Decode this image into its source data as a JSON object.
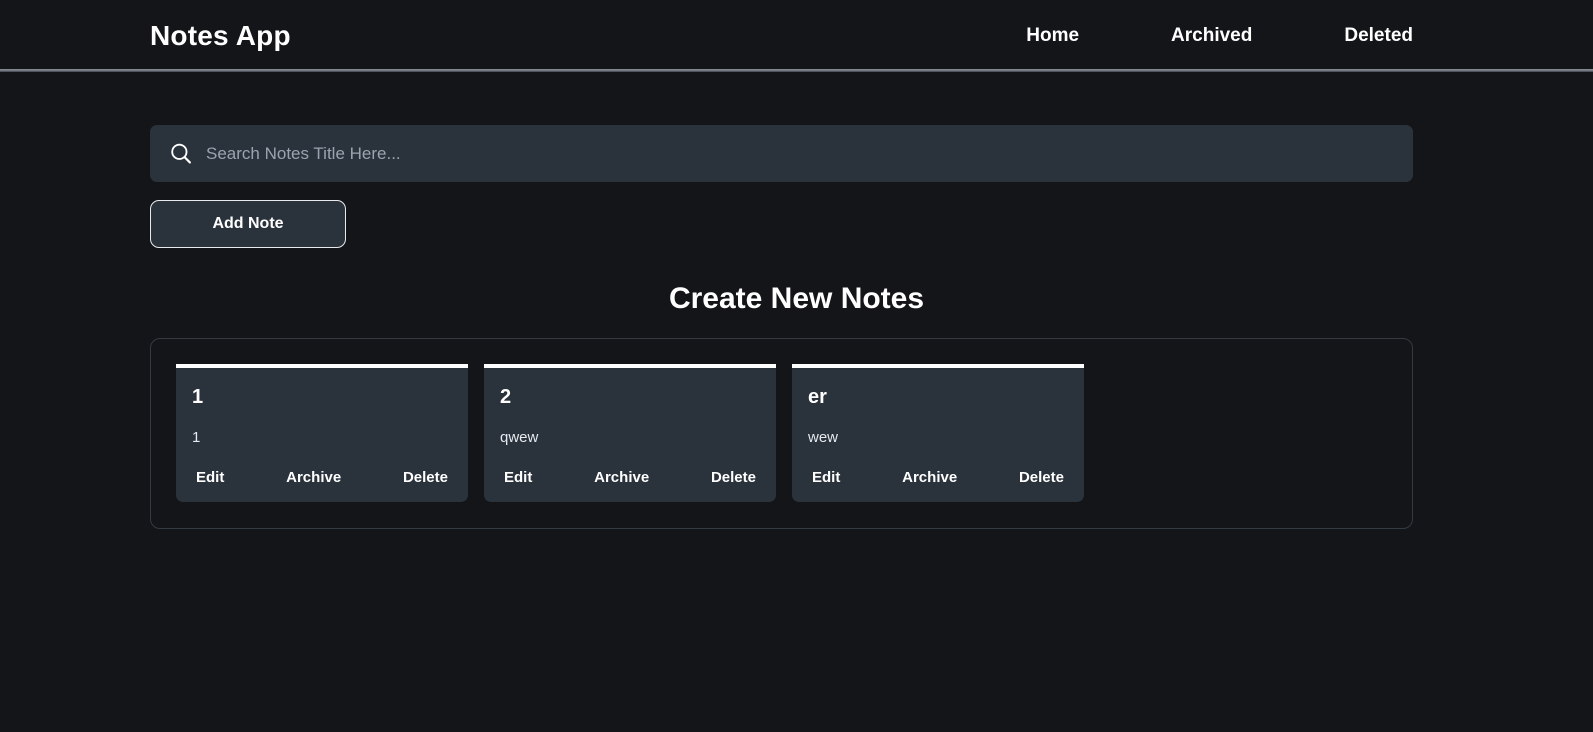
{
  "header": {
    "brand": "Notes App",
    "nav": [
      {
        "label": "Home",
        "name": "nav-link-home"
      },
      {
        "label": "Archived",
        "name": "nav-link-archived"
      },
      {
        "label": "Deleted",
        "name": "nav-link-deleted"
      }
    ]
  },
  "search": {
    "placeholder": "Search Notes Title Here...",
    "value": "",
    "icon": "search-icon"
  },
  "toolbar": {
    "add_note_label": "Add Note"
  },
  "main": {
    "section_title": "Create New Notes"
  },
  "actions": {
    "edit": "Edit",
    "archive": "Archive",
    "delete": "Delete"
  },
  "notes": [
    {
      "title": "1",
      "body": "1"
    },
    {
      "title": "2",
      "body": "qwew"
    },
    {
      "title": "er",
      "body": "wew"
    }
  ],
  "colors": {
    "page_background": "#131519",
    "card_background": "#2a323c",
    "accent_bar": "#ffffff",
    "text_primary": "#ffffff",
    "placeholder": "#9aa4b0",
    "panel_border": "#343a42"
  }
}
